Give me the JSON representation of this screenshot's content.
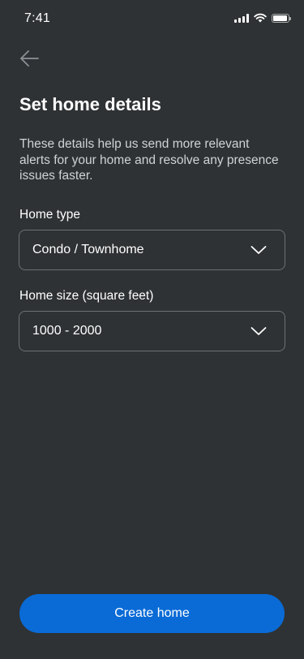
{
  "status_bar": {
    "time": "7:41",
    "icons": [
      "cellular-signal-icon",
      "wifi-icon",
      "battery-icon"
    ]
  },
  "header": {
    "back_icon": "arrow-left-icon"
  },
  "content": {
    "title": "Set home details",
    "description": "These details help us send more relevant alerts for your home and resolve any presence issues faster."
  },
  "form": {
    "home_type": {
      "label": "Home type",
      "selected_value": "Condo / Townhome",
      "icon": "chevron-down-icon"
    },
    "home_size": {
      "label": "Home size (square feet)",
      "selected_value": "1000 - 2000",
      "icon": "chevron-down-icon"
    }
  },
  "footer": {
    "create_button_label": "Create home"
  },
  "colors": {
    "background": "#2f3234",
    "accent": "#0a6bd6",
    "field_border": "#6c7176",
    "secondary_text": "#d0d3d6"
  }
}
